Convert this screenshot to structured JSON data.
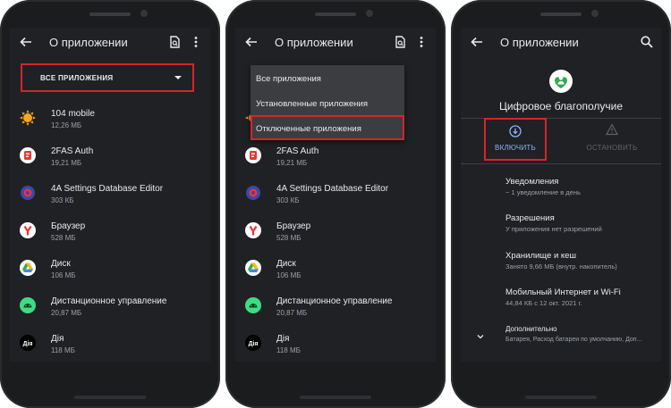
{
  "screen1": {
    "title": "О приложении",
    "filter_label": "ВСЕ ПРИЛОЖЕНИЯ",
    "apps": [
      {
        "name": "104 mobile",
        "size": "12,26 МБ",
        "icon": "sun-icon"
      },
      {
        "name": "2FAS Auth",
        "size": "19,21 МБ",
        "icon": "2fas-icon"
      },
      {
        "name": "4A Settings Database Editor",
        "size": "303 КБ",
        "icon": "gear-icon"
      },
      {
        "name": "Браузер",
        "size": "528 МБ",
        "icon": "browser-icon"
      },
      {
        "name": "Диск",
        "size": "106 МБ",
        "icon": "drive-icon"
      },
      {
        "name": "Дистанционное управление",
        "size": "20,87 МБ",
        "icon": "android-icon"
      },
      {
        "name": "Дія",
        "size": "118 МБ",
        "icon": "diia-icon"
      }
    ]
  },
  "screen2": {
    "title": "О приложении",
    "menu": [
      "Все приложения",
      "Установленные приложения",
      "Отключенные приложения"
    ],
    "apps": [
      {
        "name": "2FAS Auth",
        "size": "19,21 МБ"
      },
      {
        "name": "4A Settings Database Editor",
        "size": "303 КБ"
      },
      {
        "name": "Браузер",
        "size": "528 МБ"
      },
      {
        "name": "Диск",
        "size": "106 МБ"
      },
      {
        "name": "Дистанционное управление",
        "size": "20,87 МБ"
      },
      {
        "name": "Дія",
        "size": "118 МБ"
      }
    ]
  },
  "screen3": {
    "title": "О приложении",
    "app_name": "Цифровое благополучие",
    "enable_label": "ВКЛЮЧИТЬ",
    "stop_label": "ОСТАНОВИТЬ",
    "settings": [
      {
        "title": "Уведомления",
        "subtitle": "~ 1 уведомление в день"
      },
      {
        "title": "Разрешения",
        "subtitle": "У приложения нет разрешений"
      },
      {
        "title": "Хранилище и кеш",
        "subtitle": "Занято 9,66 МБ (внутр. накопитель)"
      },
      {
        "title": "Мобильный Интернет и Wi-Fi",
        "subtitle": "44,84 КБ с 12 окт. 2021 г."
      },
      {
        "title": "Дополнительно",
        "subtitle": "Батарея, Расход батареи по умолчанию, Доп..."
      }
    ]
  },
  "colors": {
    "screen_bg": "#202124",
    "highlight": "#d9232b",
    "accent": "#8ab4f8",
    "phone_body": "#1b1c1e"
  }
}
